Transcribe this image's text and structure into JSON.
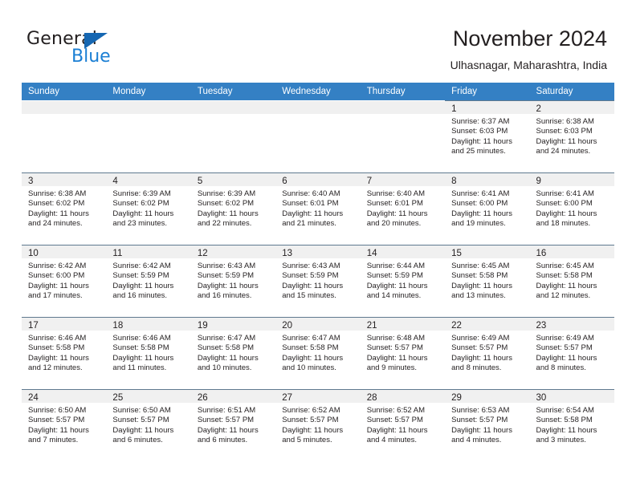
{
  "brand": {
    "name_part1": "General",
    "name_part2": "Blue",
    "triangle_icon": "blue-triangle-icon",
    "color_dark": "#231f20",
    "color_blue": "#1b7fd4"
  },
  "header": {
    "title": "November 2024",
    "subtitle": "Ulhasnagar, Maharashtra, India",
    "accent_color": "#3480c4"
  },
  "weekdays": [
    "Sunday",
    "Monday",
    "Tuesday",
    "Wednesday",
    "Thursday",
    "Friday",
    "Saturday"
  ],
  "labels": {
    "sunrise_prefix": "Sunrise:",
    "sunset_prefix": "Sunset:",
    "daylight_prefix": "Daylight:"
  },
  "weeks": [
    [
      {
        "day": "",
        "blank": true
      },
      {
        "day": "",
        "blank": true
      },
      {
        "day": "",
        "blank": true
      },
      {
        "day": "",
        "blank": true
      },
      {
        "day": "",
        "blank": true
      },
      {
        "day": "1",
        "sunrise": "Sunrise: 6:37 AM",
        "sunset": "Sunset: 6:03 PM",
        "daylight1": "Daylight: 11 hours",
        "daylight2": "and 25 minutes."
      },
      {
        "day": "2",
        "sunrise": "Sunrise: 6:38 AM",
        "sunset": "Sunset: 6:03 PM",
        "daylight1": "Daylight: 11 hours",
        "daylight2": "and 24 minutes."
      }
    ],
    [
      {
        "day": "3",
        "sunrise": "Sunrise: 6:38 AM",
        "sunset": "Sunset: 6:02 PM",
        "daylight1": "Daylight: 11 hours",
        "daylight2": "and 24 minutes."
      },
      {
        "day": "4",
        "sunrise": "Sunrise: 6:39 AM",
        "sunset": "Sunset: 6:02 PM",
        "daylight1": "Daylight: 11 hours",
        "daylight2": "and 23 minutes."
      },
      {
        "day": "5",
        "sunrise": "Sunrise: 6:39 AM",
        "sunset": "Sunset: 6:02 PM",
        "daylight1": "Daylight: 11 hours",
        "daylight2": "and 22 minutes."
      },
      {
        "day": "6",
        "sunrise": "Sunrise: 6:40 AM",
        "sunset": "Sunset: 6:01 PM",
        "daylight1": "Daylight: 11 hours",
        "daylight2": "and 21 minutes."
      },
      {
        "day": "7",
        "sunrise": "Sunrise: 6:40 AM",
        "sunset": "Sunset: 6:01 PM",
        "daylight1": "Daylight: 11 hours",
        "daylight2": "and 20 minutes."
      },
      {
        "day": "8",
        "sunrise": "Sunrise: 6:41 AM",
        "sunset": "Sunset: 6:00 PM",
        "daylight1": "Daylight: 11 hours",
        "daylight2": "and 19 minutes."
      },
      {
        "day": "9",
        "sunrise": "Sunrise: 6:41 AM",
        "sunset": "Sunset: 6:00 PM",
        "daylight1": "Daylight: 11 hours",
        "daylight2": "and 18 minutes."
      }
    ],
    [
      {
        "day": "10",
        "sunrise": "Sunrise: 6:42 AM",
        "sunset": "Sunset: 6:00 PM",
        "daylight1": "Daylight: 11 hours",
        "daylight2": "and 17 minutes."
      },
      {
        "day": "11",
        "sunrise": "Sunrise: 6:42 AM",
        "sunset": "Sunset: 5:59 PM",
        "daylight1": "Daylight: 11 hours",
        "daylight2": "and 16 minutes."
      },
      {
        "day": "12",
        "sunrise": "Sunrise: 6:43 AM",
        "sunset": "Sunset: 5:59 PM",
        "daylight1": "Daylight: 11 hours",
        "daylight2": "and 16 minutes."
      },
      {
        "day": "13",
        "sunrise": "Sunrise: 6:43 AM",
        "sunset": "Sunset: 5:59 PM",
        "daylight1": "Daylight: 11 hours",
        "daylight2": "and 15 minutes."
      },
      {
        "day": "14",
        "sunrise": "Sunrise: 6:44 AM",
        "sunset": "Sunset: 5:59 PM",
        "daylight1": "Daylight: 11 hours",
        "daylight2": "and 14 minutes."
      },
      {
        "day": "15",
        "sunrise": "Sunrise: 6:45 AM",
        "sunset": "Sunset: 5:58 PM",
        "daylight1": "Daylight: 11 hours",
        "daylight2": "and 13 minutes."
      },
      {
        "day": "16",
        "sunrise": "Sunrise: 6:45 AM",
        "sunset": "Sunset: 5:58 PM",
        "daylight1": "Daylight: 11 hours",
        "daylight2": "and 12 minutes."
      }
    ],
    [
      {
        "day": "17",
        "sunrise": "Sunrise: 6:46 AM",
        "sunset": "Sunset: 5:58 PM",
        "daylight1": "Daylight: 11 hours",
        "daylight2": "and 12 minutes."
      },
      {
        "day": "18",
        "sunrise": "Sunrise: 6:46 AM",
        "sunset": "Sunset: 5:58 PM",
        "daylight1": "Daylight: 11 hours",
        "daylight2": "and 11 minutes."
      },
      {
        "day": "19",
        "sunrise": "Sunrise: 6:47 AM",
        "sunset": "Sunset: 5:58 PM",
        "daylight1": "Daylight: 11 hours",
        "daylight2": "and 10 minutes."
      },
      {
        "day": "20",
        "sunrise": "Sunrise: 6:47 AM",
        "sunset": "Sunset: 5:58 PM",
        "daylight1": "Daylight: 11 hours",
        "daylight2": "and 10 minutes."
      },
      {
        "day": "21",
        "sunrise": "Sunrise: 6:48 AM",
        "sunset": "Sunset: 5:57 PM",
        "daylight1": "Daylight: 11 hours",
        "daylight2": "and 9 minutes."
      },
      {
        "day": "22",
        "sunrise": "Sunrise: 6:49 AM",
        "sunset": "Sunset: 5:57 PM",
        "daylight1": "Daylight: 11 hours",
        "daylight2": "and 8 minutes."
      },
      {
        "day": "23",
        "sunrise": "Sunrise: 6:49 AM",
        "sunset": "Sunset: 5:57 PM",
        "daylight1": "Daylight: 11 hours",
        "daylight2": "and 8 minutes."
      }
    ],
    [
      {
        "day": "24",
        "sunrise": "Sunrise: 6:50 AM",
        "sunset": "Sunset: 5:57 PM",
        "daylight1": "Daylight: 11 hours",
        "daylight2": "and 7 minutes."
      },
      {
        "day": "25",
        "sunrise": "Sunrise: 6:50 AM",
        "sunset": "Sunset: 5:57 PM",
        "daylight1": "Daylight: 11 hours",
        "daylight2": "and 6 minutes."
      },
      {
        "day": "26",
        "sunrise": "Sunrise: 6:51 AM",
        "sunset": "Sunset: 5:57 PM",
        "daylight1": "Daylight: 11 hours",
        "daylight2": "and 6 minutes."
      },
      {
        "day": "27",
        "sunrise": "Sunrise: 6:52 AM",
        "sunset": "Sunset: 5:57 PM",
        "daylight1": "Daylight: 11 hours",
        "daylight2": "and 5 minutes."
      },
      {
        "day": "28",
        "sunrise": "Sunrise: 6:52 AM",
        "sunset": "Sunset: 5:57 PM",
        "daylight1": "Daylight: 11 hours",
        "daylight2": "and 4 minutes."
      },
      {
        "day": "29",
        "sunrise": "Sunrise: 6:53 AM",
        "sunset": "Sunset: 5:57 PM",
        "daylight1": "Daylight: 11 hours",
        "daylight2": "and 4 minutes."
      },
      {
        "day": "30",
        "sunrise": "Sunrise: 6:54 AM",
        "sunset": "Sunset: 5:58 PM",
        "daylight1": "Daylight: 11 hours",
        "daylight2": "and 3 minutes."
      }
    ]
  ]
}
